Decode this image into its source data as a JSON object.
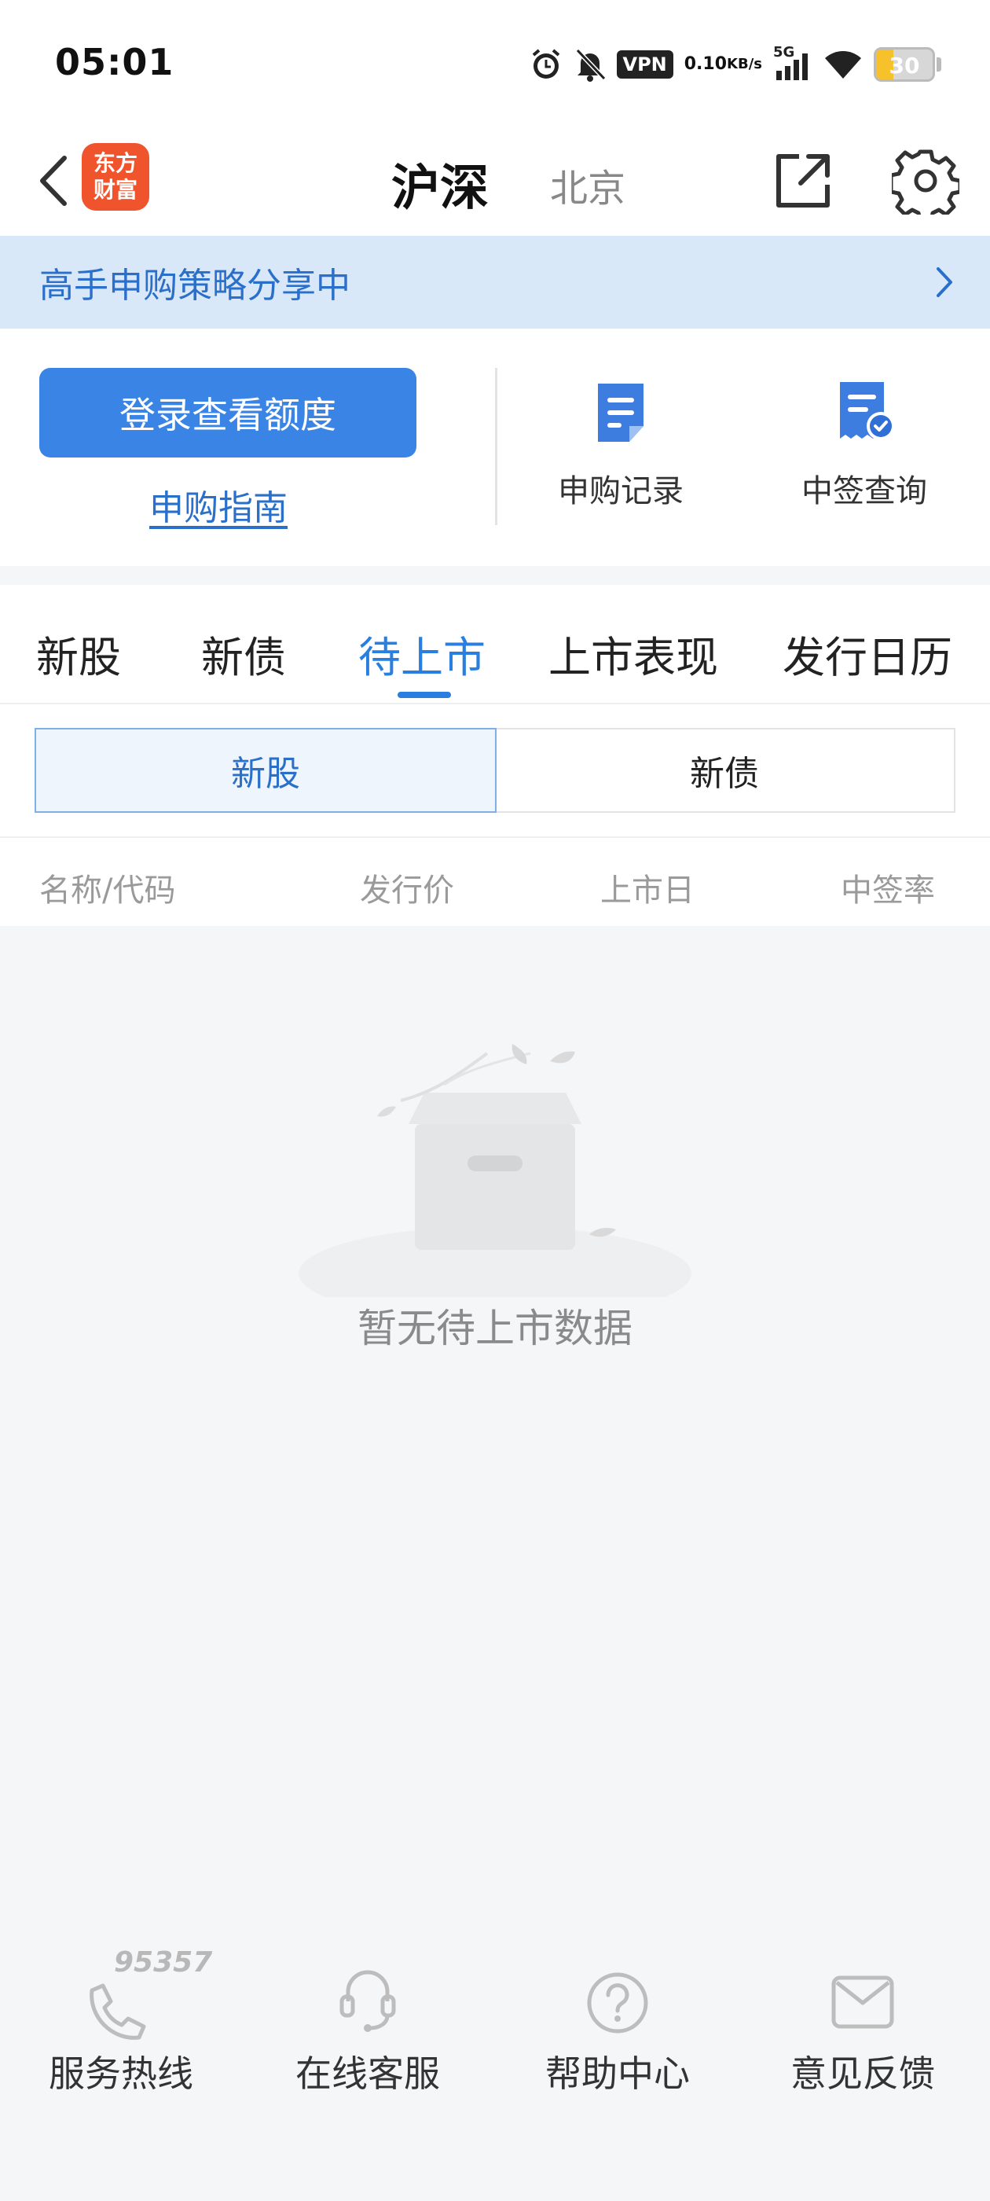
{
  "status_bar": {
    "time": "05:01",
    "vpn": "VPN",
    "net_speed_value": "0.10",
    "net_speed_unit": "KB/s",
    "network": "5G",
    "battery": "30",
    "battery_level": 0.3,
    "icons": [
      "alarm-icon",
      "mute-bell-icon",
      "vpn-icon",
      "signal-icon",
      "wifi-icon",
      "battery-icon"
    ]
  },
  "header": {
    "logo_line1": "东方",
    "logo_line2": "财富",
    "title": "沪深",
    "subtitle": "北京"
  },
  "banner": {
    "text": "高手申购策略分享中"
  },
  "action_panel": {
    "login_label": "登录查看额度",
    "guide_label": "申购指南",
    "quick_items": [
      {
        "label": "申购记录",
        "icon": "document-icon"
      },
      {
        "label": "中签查询",
        "icon": "receipt-check-icon"
      }
    ]
  },
  "tabs": {
    "items": [
      "新股",
      "新债",
      "待上市",
      "上市表现",
      "发行日历"
    ],
    "active_index": 2
  },
  "segment": {
    "items": [
      "新股",
      "新债"
    ],
    "active_index": 0
  },
  "table": {
    "columns": [
      "名称/代码",
      "发行价",
      "上市日",
      "中签率"
    ]
  },
  "empty_state": {
    "text": "暂无待上市数据"
  },
  "footer": {
    "hotline_number": "95357",
    "items": [
      {
        "label": "服务热线",
        "icon": "phone-icon"
      },
      {
        "label": "在线客服",
        "icon": "headset-icon"
      },
      {
        "label": "帮助中心",
        "icon": "help-icon"
      },
      {
        "label": "意见反馈",
        "icon": "mail-icon"
      }
    ]
  },
  "colors": {
    "accent": "#2a7ee0",
    "button": "#3a84e6",
    "banner_bg": "#d9e8f9",
    "logo": "#f0542d"
  }
}
